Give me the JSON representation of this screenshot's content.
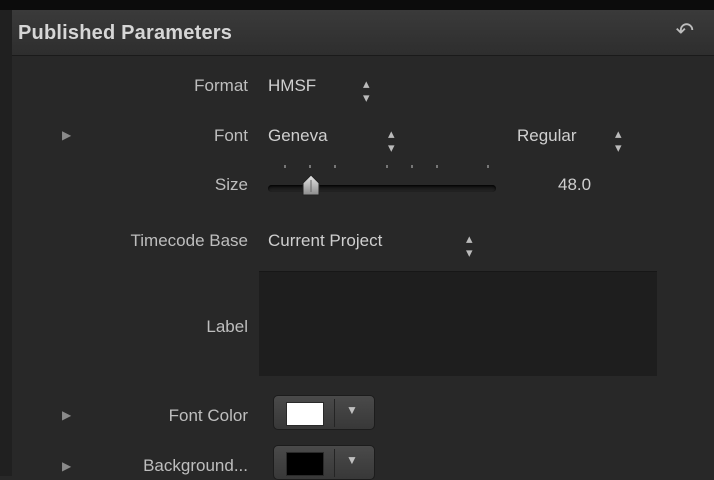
{
  "panel": {
    "title": "Published Parameters",
    "reset_icon": "undo-arrow-icon"
  },
  "format": {
    "label": "Format",
    "value": "HMSF"
  },
  "font": {
    "label": "Font",
    "family": "Geneva",
    "style": "Regular"
  },
  "size": {
    "label": "Size",
    "value": "48.0",
    "level": 0.18
  },
  "timecode_base": {
    "label": "Timecode Base",
    "value": "Current Project"
  },
  "label_field": {
    "label": "Label",
    "value": ""
  },
  "font_color": {
    "label": "Font Color",
    "color": "#ffffff"
  },
  "background": {
    "label": "Background...",
    "color": "#000000"
  },
  "colors": {
    "panel_bg": "#282828",
    "field_bg": "#1e1e1e"
  }
}
